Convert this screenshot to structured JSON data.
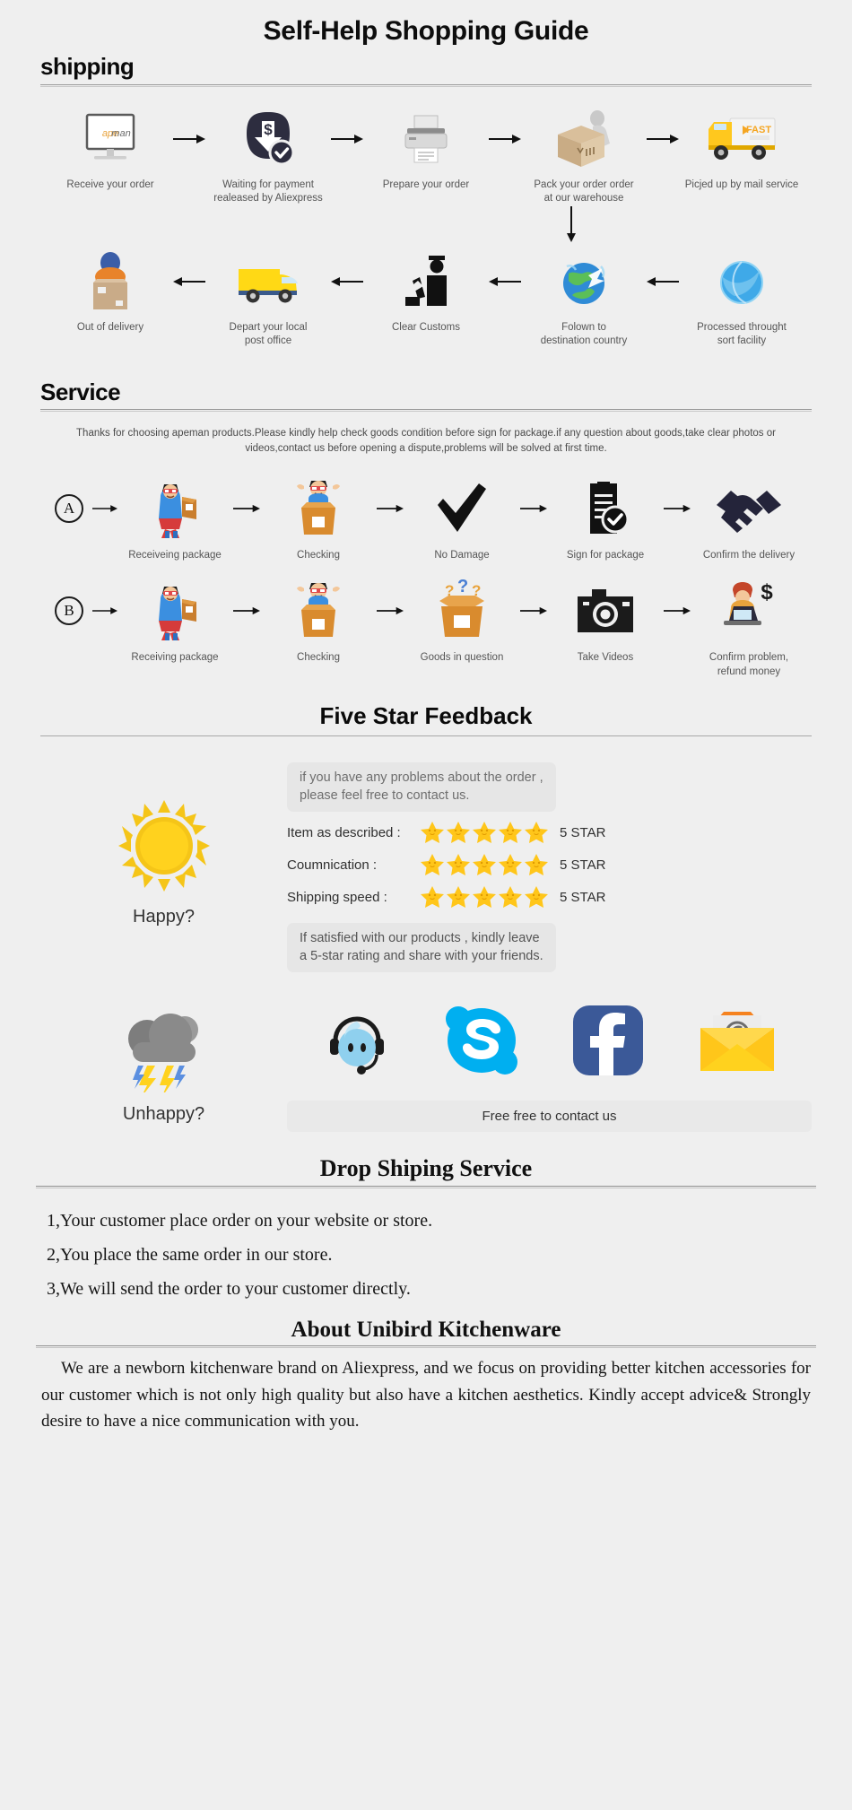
{
  "title": "Self-Help Shopping Guide",
  "shipping": {
    "heading": "shipping",
    "row1": [
      {
        "icon": "monitor-apeman-icon",
        "label": "Receive your order"
      },
      {
        "icon": "payment-dollar-icon",
        "label": "Waiting for payment\nrealeased by Aliexpress"
      },
      {
        "icon": "printer-icon",
        "label": "Prepare your order"
      },
      {
        "icon": "packing-box-worker-icon",
        "label": "Pack your order order\nat our warehouse"
      },
      {
        "icon": "fast-truck-icon",
        "label": "Picjed up by mail service"
      }
    ],
    "row2": [
      {
        "icon": "delivery-man-box-icon",
        "label": "Out of delivery"
      },
      {
        "icon": "yellow-van-icon",
        "label": "Depart your local\npost office"
      },
      {
        "icon": "customs-officer-icon",
        "label": "Clear Customs"
      },
      {
        "icon": "globe-plane-icon",
        "label": "Folown to\ndestination country"
      },
      {
        "icon": "blue-globe-icon",
        "label": "Processed throught\nsort facility"
      }
    ]
  },
  "service": {
    "heading": "Service",
    "note": "Thanks for choosing apeman products.Please kindly help check goods condition before sign for package.if any question about goods,take clear photos or videos,contact us before opening a dispute,problems will be solved at first time.",
    "rowA": {
      "badge": "A",
      "steps": [
        {
          "icon": "superhero-package-icon",
          "label": "Receiveing package"
        },
        {
          "icon": "hero-open-box-icon",
          "label": "Checking"
        },
        {
          "icon": "checkmark-icon",
          "label": "No Damage"
        },
        {
          "icon": "signed-document-icon",
          "label": "Sign for package"
        },
        {
          "icon": "handshake-icon",
          "label": "Confirm the delivery"
        }
      ]
    },
    "rowB": {
      "badge": "B",
      "steps": [
        {
          "icon": "superhero-package-icon",
          "label": "Receiving package"
        },
        {
          "icon": "hero-open-box-icon",
          "label": "Checking"
        },
        {
          "icon": "question-box-icon",
          "label": "Goods in question"
        },
        {
          "icon": "camera-icon",
          "label": "Take Videos"
        },
        {
          "icon": "refund-person-icon",
          "label": "Confirm problem,\nrefund money"
        }
      ]
    }
  },
  "feedback": {
    "heading": "Five Star Feedback",
    "happy_label": "Happy?",
    "unhappy_label": "Unhappy?",
    "top_bubble": "if you have any problems about the order ,\nplease feel free to contact us.",
    "bottom_bubble": "If satisfied with our products ,  kindly leave\na 5-star rating and share with your friends.",
    "ratings": [
      {
        "label": "Item as described :",
        "stars": 5,
        "value": "5 STAR"
      },
      {
        "label": "Coumnication :",
        "stars": 5,
        "value": "5 STAR"
      },
      {
        "label": "Shipping speed :",
        "stars": 5,
        "value": "5 STAR"
      }
    ],
    "socials": [
      {
        "icon": "trademanager-headset-icon"
      },
      {
        "icon": "skype-icon"
      },
      {
        "icon": "facebook-icon"
      },
      {
        "icon": "email-envelope-icon"
      }
    ],
    "contact_button": "Free free to contact us"
  },
  "dropship": {
    "heading": "Drop Shiping Service",
    "items": [
      "1,Your customer place order on your website or store.",
      "2,You place the same order in our store.",
      "3,We will send the order to your customer directly."
    ]
  },
  "about": {
    "heading": "About Unibird Kitchenware",
    "body": "We are a newborn kitchenware brand on Aliexpress, and we focus on providing better kitchen accessories for our customer which is not only high quality but also have a kitchen aesthetics. Kindly accept advice& Strongly desire to have a nice communication with you."
  },
  "colors": {
    "bg": "#efefef",
    "star": "#FFC61A",
    "sun": "#F5C518",
    "skype": "#00AFF0",
    "facebook": "#3B5998",
    "truck": "#FFC81E",
    "dark": "#2b2b3d"
  }
}
